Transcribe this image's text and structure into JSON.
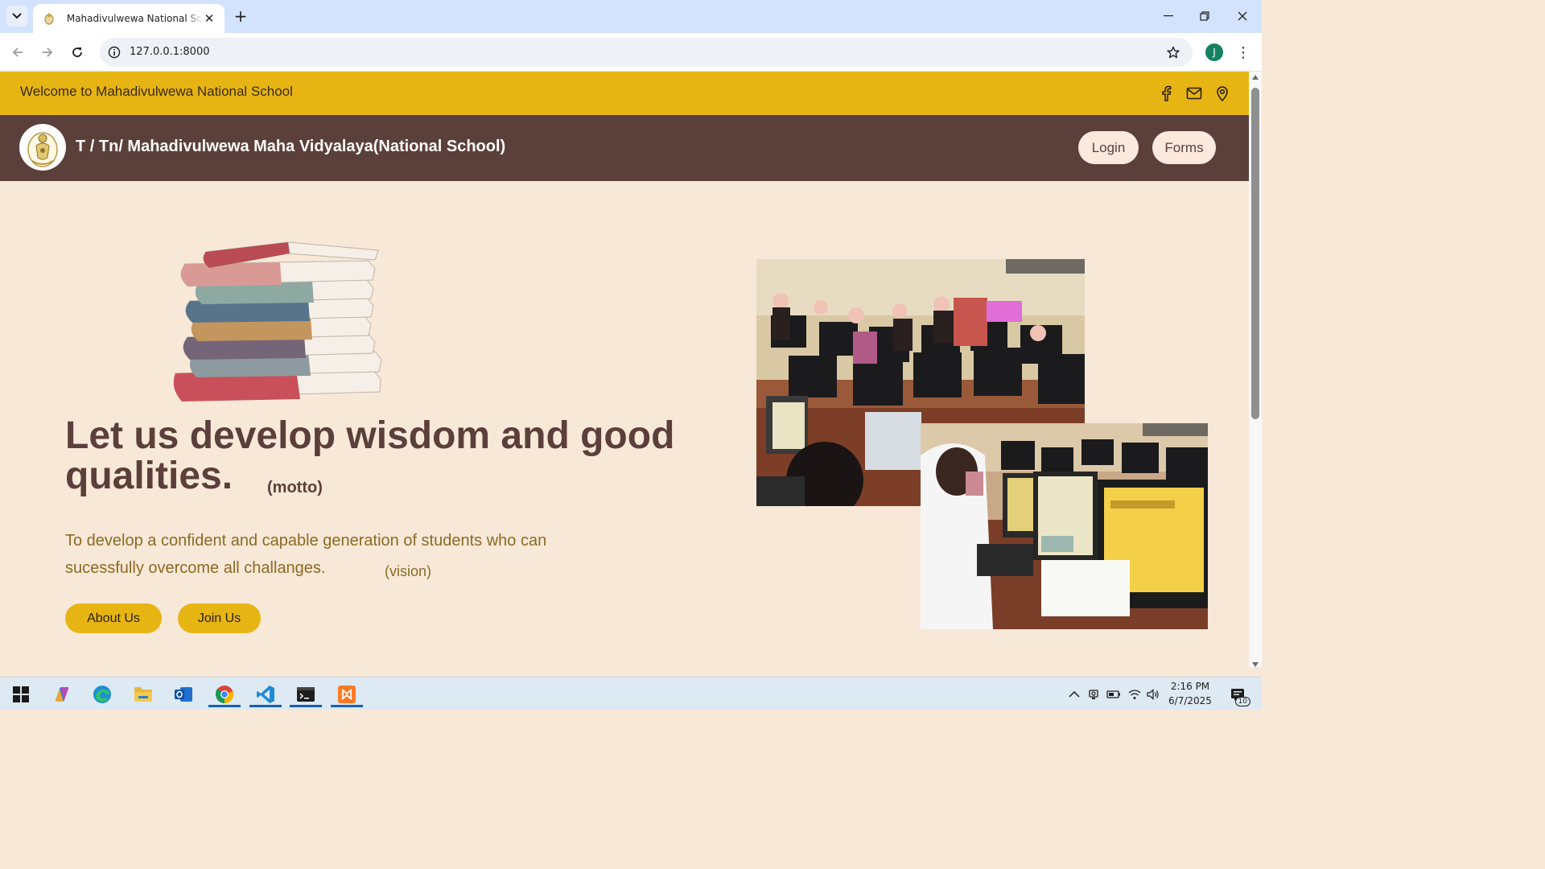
{
  "browser": {
    "tab_title": "Mahadivulwewa National School",
    "url": "127.0.0.1:8000",
    "profile_initial": "J"
  },
  "topbar": {
    "welcome": "Welcome to Mahadivulwewa National School",
    "icons": [
      "facebook-icon",
      "mail-icon",
      "location-pin-icon"
    ]
  },
  "navbar": {
    "school_name": "T / Tn/ Mahadivulwewa Maha Vidyalaya(National School)",
    "login_label": "Login",
    "forms_label": "Forms"
  },
  "hero": {
    "motto": "Let us develop wisdom and good qualities.",
    "motto_tag": "(motto)",
    "vision": "To develop a confident and capable generation of students who can sucessfully overcome all challanges.",
    "vision_tag": "(vision)",
    "about_label": "About Us",
    "join_label": "Join Us"
  },
  "taskbar": {
    "apps": [
      "windows-start-icon",
      "copilot-icon",
      "edge-icon",
      "file-explorer-icon",
      "outlook-icon",
      "chrome-icon",
      "vscode-icon",
      "terminal-icon",
      "xampp-icon"
    ],
    "time": "2:16 PM",
    "date": "6/7/2025",
    "notification_count": "10"
  },
  "colors": {
    "topbar": "#e6b514",
    "navbar": "#5b3f3a",
    "page_bg": "#f8e8d8",
    "accent_button": "#e6b514",
    "pill_button": "#fbe9dd",
    "motto_text": "#5b3f3a",
    "vision_text": "#8b6a22"
  }
}
